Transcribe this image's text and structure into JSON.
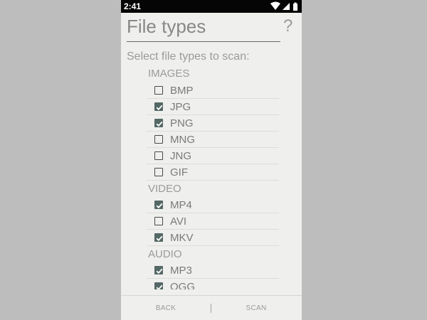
{
  "status": {
    "time": "2:41",
    "icons": [
      "wifi-icon",
      "cellular-signal-icon",
      "battery-icon"
    ]
  },
  "header": {
    "title": "File types",
    "help": "?"
  },
  "prompt": "Select file types to scan:",
  "categories": [
    {
      "title": "IMAGES",
      "items": [
        {
          "label": "BMP",
          "checked": false
        },
        {
          "label": "JPG",
          "checked": true
        },
        {
          "label": "PNG",
          "checked": true
        },
        {
          "label": "MNG",
          "checked": false
        },
        {
          "label": "JNG",
          "checked": false
        },
        {
          "label": "GIF",
          "checked": false
        }
      ]
    },
    {
      "title": "VIDEO",
      "items": [
        {
          "label": "MP4",
          "checked": true
        },
        {
          "label": "AVI",
          "checked": false
        },
        {
          "label": "MKV",
          "checked": true
        }
      ]
    },
    {
      "title": "AUDIO",
      "items": [
        {
          "label": "MP3",
          "checked": true
        },
        {
          "label": "OGG",
          "checked": true
        }
      ]
    }
  ],
  "bottom_bar": {
    "back_label": "BACK",
    "scan_label": "SCAN"
  },
  "colors": {
    "checkbox_checked": "#546866",
    "status_bar": "#050505",
    "background": "#efefee"
  }
}
